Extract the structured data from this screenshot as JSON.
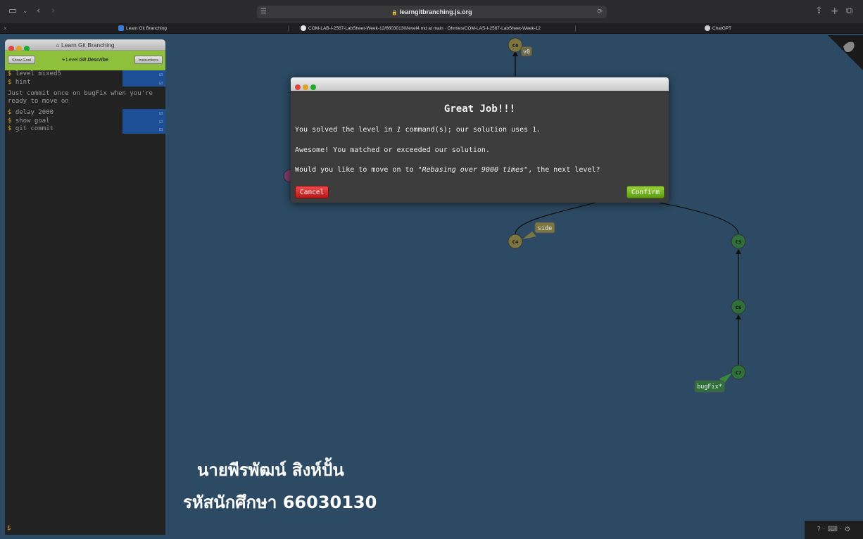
{
  "browser": {
    "url": "learngitbranching.js.org",
    "tabs": [
      {
        "label": "Learn Git Branching"
      },
      {
        "label": "COM-LAB-I-2567-LabSheet-Week-12/66030130/level4.md at main · Ohmies/COM-LAS-I-2567-LabSheet-Week-12"
      },
      {
        "label": "ChatGPT"
      }
    ],
    "close_tab": "×"
  },
  "terminal": {
    "title": "Learn Git Branching",
    "show_goal_label": "Show Goal",
    "level_prefix": "Level",
    "level_name": "Git Describe",
    "instructions_label": "Instructions",
    "commands_a": [
      {
        "prompt": "$",
        "text": "level mixed5"
      },
      {
        "prompt": "$",
        "text": "hint"
      }
    ],
    "message": "Just commit once on bugFix when you're ready to move on",
    "commands_b": [
      {
        "prompt": "$",
        "text": "delay 2000"
      },
      {
        "prompt": "$",
        "text": "show goal"
      },
      {
        "prompt": "$",
        "text": "git commit"
      }
    ],
    "check_glyph": "☑",
    "input_prompt": "$"
  },
  "dialog": {
    "title": "Great Job!!!",
    "line1_a": "You solved the level in ",
    "line1_count": "1",
    "line1_b": " command(s); our solution uses 1.",
    "line2": "Awesome! You matched or exceeded our solution.",
    "line3_a": "Would you like to move on to \"",
    "line3_level": "Rebasing over 9000 times",
    "line3_b": "\", the next level?",
    "cancel_label": "Cancel",
    "confirm_label": "Confirm"
  },
  "graph": {
    "commits": [
      "C0",
      "C4",
      "C5",
      "C6",
      "C7"
    ],
    "tags": [
      "v0"
    ],
    "branches": [
      "side",
      "bugFix*"
    ]
  },
  "overlay": {
    "name": "นายพีรพัฒน์ สิงห์ปั้น",
    "student_id": "รหัสนักศึกษา 66030130"
  },
  "bottom_tools": "? · ⌨ · ⚙",
  "colors": {
    "canvas": "#2c4a63",
    "commit_fill": "#2f6f3a",
    "tag_fill": "#7d7540",
    "level_bar": "#8fc03c"
  }
}
